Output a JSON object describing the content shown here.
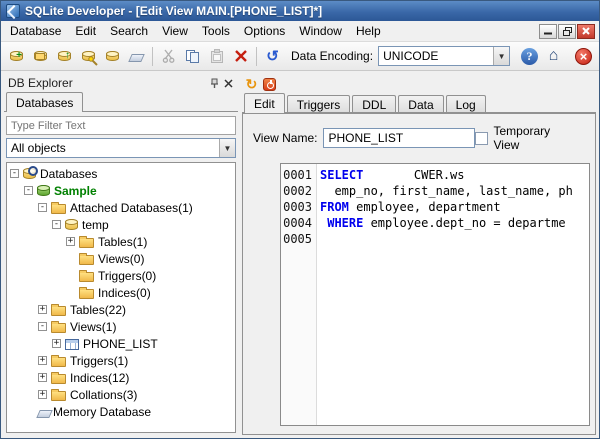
{
  "window": {
    "title": "SQLite Developer - [Edit View MAIN.[PHONE_LIST]*]",
    "controls": [
      "minimize",
      "restore",
      "close"
    ]
  },
  "menu": {
    "items": [
      "Database",
      "Edit",
      "Search",
      "View",
      "Tools",
      "Options",
      "Window",
      "Help"
    ]
  },
  "toolbar": {
    "encoding_label": "Data Encoding:",
    "encoding_value": "UNICODE",
    "icons": [
      "new-database-icon",
      "open-database-icon",
      "attach-database-icon",
      "database-key-icon",
      "database-icon",
      "erase-icon",
      "cut-icon",
      "copy-icon",
      "paste-icon",
      "delete-icon",
      "history-icon",
      "help-icon",
      "home-icon",
      "stop-icon"
    ],
    "dropdown_arrow": "▼"
  },
  "explorer": {
    "title": "DB Explorer",
    "header_icons": [
      "pin-icon",
      "close-icon"
    ],
    "tab_label": "Databases",
    "filter_placeholder": "Type Filter Text",
    "objects_combo_value": "All objects",
    "tree": [
      {
        "label": "Databases",
        "level": 0,
        "expander": "-",
        "icon": "databases-search-icon"
      },
      {
        "label": "Sample",
        "level": 1,
        "expander": "-",
        "icon": "database-green-icon"
      },
      {
        "label": "Attached Databases(1)",
        "level": 2,
        "expander": "-",
        "icon": "folder-icon"
      },
      {
        "label": "temp",
        "level": 3,
        "expander": "-",
        "icon": "database-icon"
      },
      {
        "label": "Tables(1)",
        "level": 4,
        "expander": "+",
        "icon": "folder-icon"
      },
      {
        "label": "Views(0)",
        "level": 4,
        "expander": "",
        "icon": "folder-icon"
      },
      {
        "label": "Triggers(0)",
        "level": 4,
        "expander": "",
        "icon": "folder-icon"
      },
      {
        "label": "Indices(0)",
        "level": 4,
        "expander": "",
        "icon": "folder-icon"
      },
      {
        "label": "Tables(22)",
        "level": 2,
        "expander": "+",
        "icon": "folder-icon"
      },
      {
        "label": "Views(1)",
        "level": 2,
        "expander": "-",
        "icon": "folder-icon"
      },
      {
        "label": "PHONE_LIST",
        "level": 3,
        "expander": "+",
        "icon": "table-icon"
      },
      {
        "label": "Triggers(1)",
        "level": 2,
        "expander": "+",
        "icon": "folder-icon"
      },
      {
        "label": "Indices(12)",
        "level": 2,
        "expander": "+",
        "icon": "folder-icon"
      },
      {
        "label": "Collations(3)",
        "level": 2,
        "expander": "+",
        "icon": "folder-icon"
      },
      {
        "label": "Memory Database",
        "level": 1,
        "expander": "",
        "icon": "eraser-icon"
      }
    ]
  },
  "editor": {
    "mini_toolbar_icons": [
      "refresh-icon",
      "power-icon"
    ],
    "tabs": [
      "Edit",
      "Triggers",
      "DDL",
      "Data",
      "Log"
    ],
    "active_tab": "Edit",
    "view_name_label": "View Name:",
    "view_name_value": "PHONE_LIST",
    "temporary_view_label": "Temporary View",
    "code_lines": [
      {
        "num": "0001",
        "pre": "",
        "kw": "SELECT",
        "rest": "       CWER.ws"
      },
      {
        "num": "0002",
        "pre": "  emp_no, first_name, last_name, ph",
        "kw": "",
        "rest": ""
      },
      {
        "num": "0003",
        "pre": "",
        "kw": "FROM",
        "rest": " employee, department"
      },
      {
        "num": "0004",
        "pre": " ",
        "kw": "WHERE",
        "rest": " employee.dept_no = departme"
      },
      {
        "num": "0005",
        "pre": "",
        "kw": "",
        "rest": ""
      }
    ],
    "keyword_color": "#0000ee"
  },
  "colors": {
    "titlebar_blue": "#3a68a8",
    "keyword_blue": "#0000ee",
    "sample_green": "#008000",
    "stop_red": "#c51f10"
  }
}
